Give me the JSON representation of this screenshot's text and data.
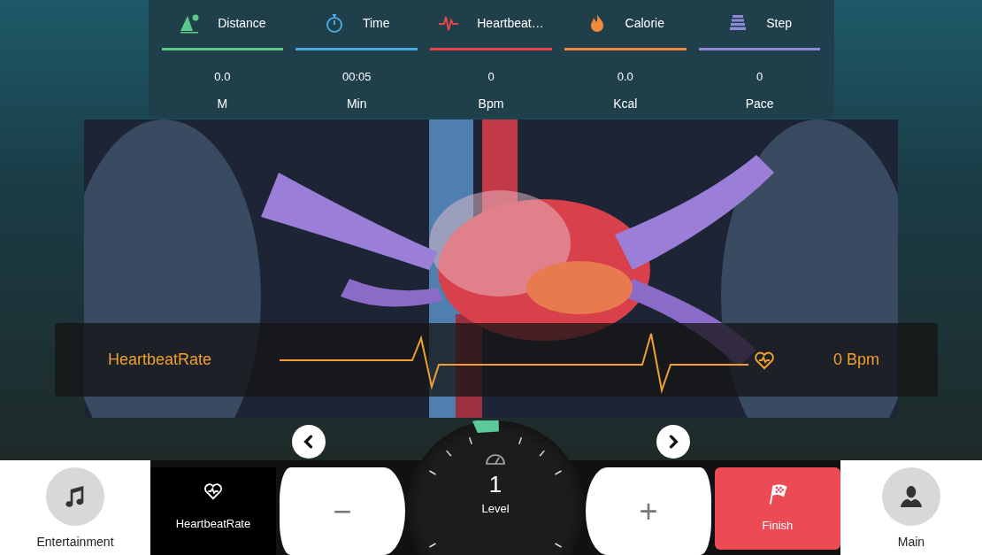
{
  "stats": [
    {
      "kind": "distance",
      "label": "Distance",
      "color": "#5cc98a",
      "value": "0.0",
      "unit": "M"
    },
    {
      "kind": "time",
      "label": "Time",
      "color": "#4aa8e0",
      "value": "00:05",
      "unit": "Min"
    },
    {
      "kind": "heartbeat",
      "label": "Heartbeat…",
      "color": "#e8434a",
      "value": "0",
      "unit": "Bpm"
    },
    {
      "kind": "calorie",
      "label": "Calorie",
      "color": "#f08a3c",
      "value": "0.0",
      "unit": "Kcal"
    },
    {
      "kind": "step",
      "label": "Step",
      "color": "#8e88d8",
      "value": "0",
      "unit": "Pace"
    }
  ],
  "heart_rate": {
    "label": "HeartbeatRate",
    "reading": "0 Bpm"
  },
  "bottom": {
    "left": {
      "label": "Entertainment"
    },
    "mode": {
      "label": "HeartbeatRate"
    },
    "minus": "−",
    "plus": "+",
    "level": {
      "value": "1",
      "label": "Level"
    },
    "finish": {
      "label": "Finish"
    },
    "right": {
      "label": "Main"
    }
  }
}
